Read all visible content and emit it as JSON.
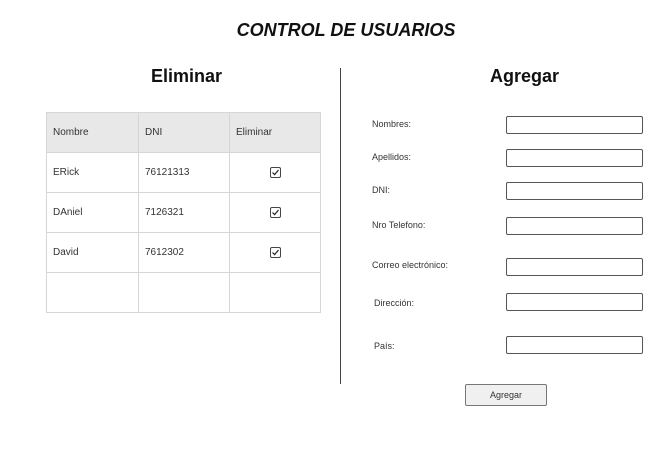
{
  "page": {
    "title": "CONTROL DE USUARIOS"
  },
  "delete_section": {
    "title": "Eliminar",
    "columns": [
      "Nombre",
      "DNI",
      "Eliminar"
    ],
    "rows": [
      {
        "name": "ERick",
        "dni": "76121313",
        "checked": true
      },
      {
        "name": "DAniel",
        "dni": "7126321",
        "checked": true
      },
      {
        "name": "David",
        "dni": "7612302",
        "checked": true
      }
    ]
  },
  "add_section": {
    "title": "Agregar",
    "fields": [
      {
        "label": "Nombres:",
        "value": ""
      },
      {
        "label": "Apellidos:",
        "value": ""
      },
      {
        "label": "DNI:",
        "value": ""
      },
      {
        "label": "Nro Telefono:",
        "value": ""
      },
      {
        "label": "Correo electrónico:",
        "value": ""
      },
      {
        "label": "Dirección:",
        "value": ""
      },
      {
        "label": "País:",
        "value": ""
      }
    ],
    "submit_label": "Agregar"
  }
}
